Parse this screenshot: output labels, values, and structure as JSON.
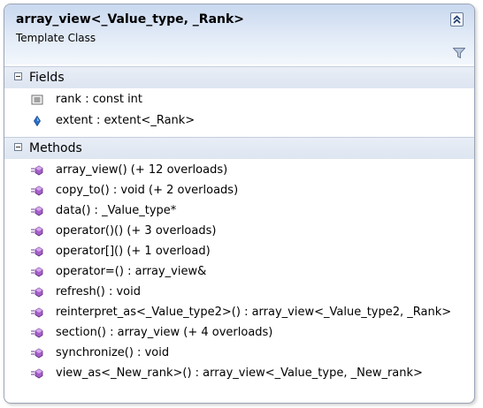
{
  "header": {
    "title": "array_view<_Value_type, _Rank>",
    "subtitle": "Template Class"
  },
  "sections": {
    "fields": {
      "label": "Fields",
      "items": [
        {
          "text": "rank : const int",
          "icon": "constant-field-icon"
        },
        {
          "text": "extent : extent<_Rank>",
          "icon": "property-icon"
        }
      ]
    },
    "methods": {
      "label": "Methods",
      "items": [
        {
          "text": "array_view() (+ 12 overloads)",
          "icon": "method-icon"
        },
        {
          "text": "copy_to() : void (+ 2 overloads)",
          "icon": "method-icon"
        },
        {
          "text": "data() : _Value_type*",
          "icon": "method-icon"
        },
        {
          "text": "operator()() (+ 3 overloads)",
          "icon": "method-icon"
        },
        {
          "text": "operator[]() (+ 1 overload)",
          "icon": "method-icon"
        },
        {
          "text": "operator=() : array_view&",
          "icon": "method-icon"
        },
        {
          "text": "refresh() : void",
          "icon": "method-icon"
        },
        {
          "text": "reinterpret_as<_Value_type2>() : array_view<_Value_type2, _Rank>",
          "icon": "method-icon"
        },
        {
          "text": "section() : array_view (+ 4 overloads)",
          "icon": "method-icon"
        },
        {
          "text": "synchronize() : void",
          "icon": "method-icon"
        },
        {
          "text": "view_as<_New_rank>() : array_view<_Value_type, _New_rank>",
          "icon": "method-icon"
        }
      ]
    }
  }
}
